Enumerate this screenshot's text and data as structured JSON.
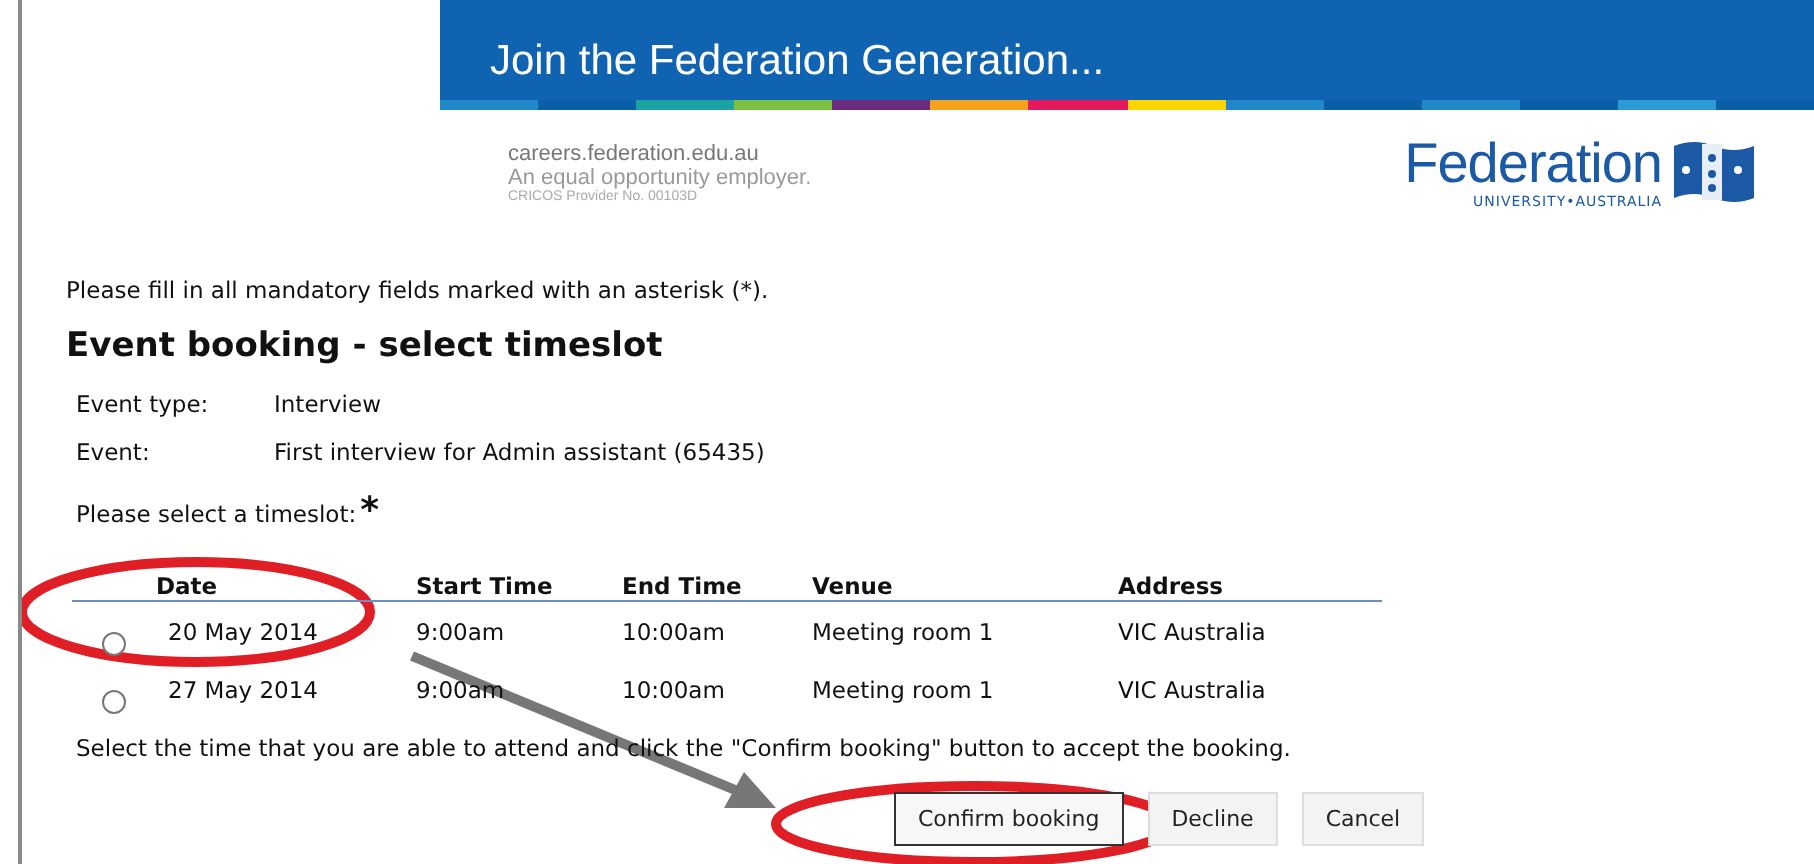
{
  "banner": {
    "title": "Join the Federation Generation...",
    "site": "careers.federation.edu.au",
    "tagline": "An equal opportunity employer.",
    "provider": "CRICOS Provider No. 00103D",
    "logo_name": "Federation",
    "logo_sub": "UNIVERSITY•AUSTRALIA"
  },
  "instruction": "Please fill in all mandatory fields marked with an asterisk (*).",
  "heading": "Event booking - select timeslot",
  "details": [
    {
      "label": "Event type:",
      "value": "Interview"
    },
    {
      "label": "Event:",
      "value": "First interview for Admin assistant (65435)"
    }
  ],
  "prompt": {
    "text": "Please select a timeslot:",
    "required_mark": "*"
  },
  "table": {
    "columns": [
      "Date",
      "Start Time",
      "End Time",
      "Venue",
      "Address"
    ],
    "rows": [
      {
        "selected": false,
        "cells": [
          "20 May 2014",
          "9:00am",
          "10:00am",
          "Meeting room 1",
          "VIC Australia"
        ]
      },
      {
        "selected": false,
        "cells": [
          "27 May 2014",
          "9:00am",
          "10:00am",
          "Meeting room 1",
          "VIC Australia"
        ]
      }
    ]
  },
  "note": "Select the time that you are able to attend and click the \"Confirm booking\" button to accept the booking.",
  "buttons": [
    {
      "label": "Confirm booking",
      "kind": "primary"
    },
    {
      "label": "Decline",
      "kind": "plain"
    },
    {
      "label": "Cancel",
      "kind": "plain"
    }
  ]
}
